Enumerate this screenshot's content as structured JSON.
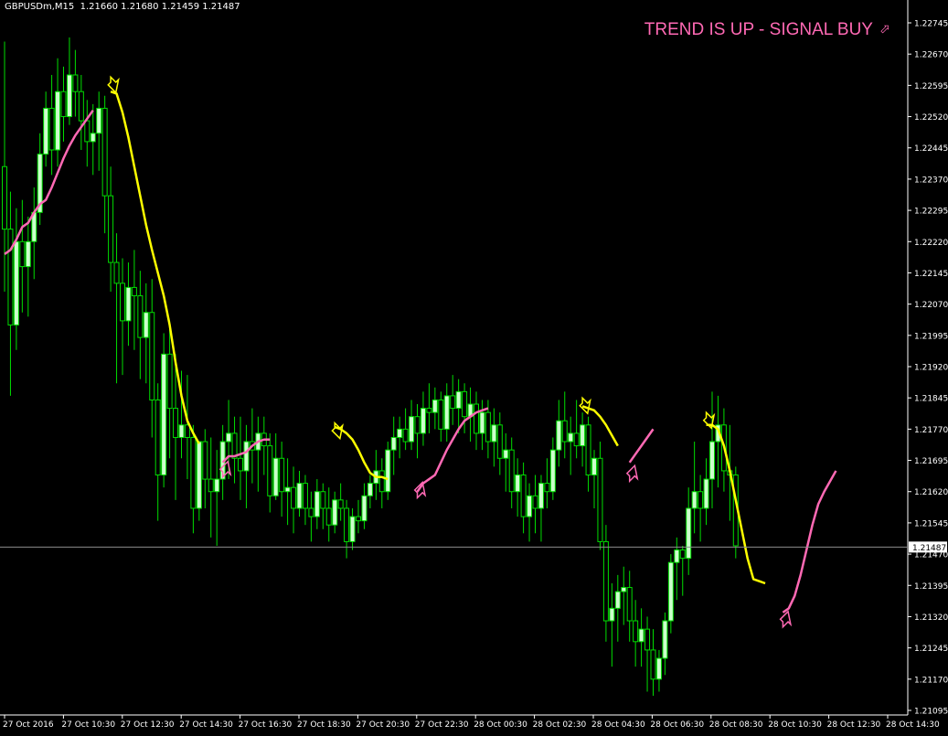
{
  "header": {
    "symbol_timeframe": "GBPUSDm,M15",
    "ohlc": "1.21660 1.21680 1.21459 1.21487"
  },
  "signal": {
    "text": "TREND IS UP - SIGNAL BUY",
    "icon": "arrow-up-right-icon",
    "color": "#ff69b4"
  },
  "colors": {
    "background": "#000000",
    "bull_candle": "#ccffcc",
    "wick": "#00dd00",
    "bear_candle": "#000000",
    "down_trend": "#ffff00",
    "up_trend": "#ff69b4",
    "axis_text": "#ffffff",
    "price_line": "#8c8c8c"
  },
  "chart_data": {
    "type": "candlestick",
    "symbol": "GBPUSDm",
    "timeframe": "M15",
    "y_ticks": [
      "1.22745",
      "1.22670",
      "1.22595",
      "1.22520",
      "1.22445",
      "1.22370",
      "1.22295",
      "1.22220",
      "1.22145",
      "1.22070",
      "1.21995",
      "1.21920",
      "1.21845",
      "1.21770",
      "1.21695",
      "1.21620",
      "1.21545",
      "1.21470",
      "1.21395",
      "1.21320",
      "1.21245",
      "1.21170",
      "1.21095"
    ],
    "ylim": [
      1.21095,
      1.22745
    ],
    "x_ticks": [
      "27 Oct 2016",
      "27 Oct 10:30",
      "27 Oct 12:30",
      "27 Oct 14:30",
      "27 Oct 16:30",
      "27 Oct 18:30",
      "27 Oct 20:30",
      "27 Oct 22:30",
      "28 Oct 00:30",
      "28 Oct 02:30",
      "28 Oct 04:30",
      "28 Oct 06:30",
      "28 Oct 08:30",
      "28 Oct 10:30",
      "28 Oct 12:30",
      "28 Oct 14:30"
    ],
    "current_price": "1.21487",
    "candles": [
      {
        "o": 1.224,
        "h": 1.227,
        "l": 1.221,
        "c": 1.2225
      },
      {
        "o": 1.2225,
        "h": 1.2234,
        "l": 1.2185,
        "c": 1.2202
      },
      {
        "o": 1.2202,
        "h": 1.223,
        "l": 1.2196,
        "c": 1.2222
      },
      {
        "o": 1.2222,
        "h": 1.2232,
        "l": 1.2205,
        "c": 1.2216
      },
      {
        "o": 1.2216,
        "h": 1.2228,
        "l": 1.2204,
        "c": 1.2222
      },
      {
        "o": 1.2222,
        "h": 1.2235,
        "l": 1.2213,
        "c": 1.2229
      },
      {
        "o": 1.2229,
        "h": 1.2248,
        "l": 1.2226,
        "c": 1.2243
      },
      {
        "o": 1.2243,
        "h": 1.2258,
        "l": 1.224,
        "c": 1.2254
      },
      {
        "o": 1.2254,
        "h": 1.2262,
        "l": 1.2238,
        "c": 1.2244
      },
      {
        "o": 1.2244,
        "h": 1.2266,
        "l": 1.224,
        "c": 1.2258
      },
      {
        "o": 1.2258,
        "h": 1.2264,
        "l": 1.2246,
        "c": 1.2252
      },
      {
        "o": 1.2252,
        "h": 1.2271,
        "l": 1.225,
        "c": 1.2262
      },
      {
        "o": 1.2262,
        "h": 1.2268,
        "l": 1.2252,
        "c": 1.2258
      },
      {
        "o": 1.2258,
        "h": 1.2262,
        "l": 1.2244,
        "c": 1.2251
      },
      {
        "o": 1.2251,
        "h": 1.2256,
        "l": 1.224,
        "c": 1.2246
      },
      {
        "o": 1.2246,
        "h": 1.2255,
        "l": 1.2238,
        "c": 1.2248
      },
      {
        "o": 1.2248,
        "h": 1.2258,
        "l": 1.2239,
        "c": 1.2254
      },
      {
        "o": 1.2254,
        "h": 1.2257,
        "l": 1.2224,
        "c": 1.2233
      },
      {
        "o": 1.2233,
        "h": 1.224,
        "l": 1.221,
        "c": 1.2217
      },
      {
        "o": 1.2217,
        "h": 1.2224,
        "l": 1.2188,
        "c": 1.2212
      },
      {
        "o": 1.2212,
        "h": 1.2218,
        "l": 1.219,
        "c": 1.2203
      },
      {
        "o": 1.2203,
        "h": 1.2217,
        "l": 1.2197,
        "c": 1.2211
      },
      {
        "o": 1.2211,
        "h": 1.222,
        "l": 1.2196,
        "c": 1.2209
      },
      {
        "o": 1.2209,
        "h": 1.2215,
        "l": 1.2189,
        "c": 1.2199
      },
      {
        "o": 1.2199,
        "h": 1.2212,
        "l": 1.2188,
        "c": 1.2205
      },
      {
        "o": 1.2205,
        "h": 1.2213,
        "l": 1.2175,
        "c": 1.2184
      },
      {
        "o": 1.2184,
        "h": 1.2188,
        "l": 1.2155,
        "c": 1.2166
      },
      {
        "o": 1.2166,
        "h": 1.22,
        "l": 1.2163,
        "c": 1.2195
      },
      {
        "o": 1.2195,
        "h": 1.2203,
        "l": 1.217,
        "c": 1.2182
      },
      {
        "o": 1.2182,
        "h": 1.2195,
        "l": 1.216,
        "c": 1.2175
      },
      {
        "o": 1.2175,
        "h": 1.2191,
        "l": 1.217,
        "c": 1.2178
      },
      {
        "o": 1.2178,
        "h": 1.219,
        "l": 1.2165,
        "c": 1.2175
      },
      {
        "o": 1.2175,
        "h": 1.2178,
        "l": 1.2152,
        "c": 1.2158
      },
      {
        "o": 1.2158,
        "h": 1.2173,
        "l": 1.2155,
        "c": 1.2174
      },
      {
        "o": 1.2174,
        "h": 1.2177,
        "l": 1.2158,
        "c": 1.2165
      },
      {
        "o": 1.2165,
        "h": 1.2175,
        "l": 1.2151,
        "c": 1.2162
      },
      {
        "o": 1.2162,
        "h": 1.2172,
        "l": 1.2149,
        "c": 1.2165
      },
      {
        "o": 1.2165,
        "h": 1.2178,
        "l": 1.216,
        "c": 1.2174
      },
      {
        "o": 1.2174,
        "h": 1.2184,
        "l": 1.2165,
        "c": 1.2176
      },
      {
        "o": 1.2176,
        "h": 1.218,
        "l": 1.2164,
        "c": 1.217
      },
      {
        "o": 1.217,
        "h": 1.218,
        "l": 1.216,
        "c": 1.2167
      },
      {
        "o": 1.2167,
        "h": 1.2178,
        "l": 1.2158,
        "c": 1.2174
      },
      {
        "o": 1.2174,
        "h": 1.2182,
        "l": 1.2164,
        "c": 1.2172
      },
      {
        "o": 1.2172,
        "h": 1.218,
        "l": 1.2162,
        "c": 1.2176
      },
      {
        "o": 1.2176,
        "h": 1.218,
        "l": 1.2166,
        "c": 1.2173
      },
      {
        "o": 1.2173,
        "h": 1.2176,
        "l": 1.2157,
        "c": 1.2161
      },
      {
        "o": 1.2161,
        "h": 1.2176,
        "l": 1.216,
        "c": 1.217
      },
      {
        "o": 1.217,
        "h": 1.2174,
        "l": 1.2156,
        "c": 1.2162
      },
      {
        "o": 1.2162,
        "h": 1.217,
        "l": 1.2154,
        "c": 1.2163
      },
      {
        "o": 1.2163,
        "h": 1.2168,
        "l": 1.2152,
        "c": 1.2158
      },
      {
        "o": 1.2158,
        "h": 1.2167,
        "l": 1.2156,
        "c": 1.2164
      },
      {
        "o": 1.2164,
        "h": 1.2166,
        "l": 1.2154,
        "c": 1.2158
      },
      {
        "o": 1.2158,
        "h": 1.2162,
        "l": 1.215,
        "c": 1.2156
      },
      {
        "o": 1.2156,
        "h": 1.2165,
        "l": 1.2153,
        "c": 1.2162
      },
      {
        "o": 1.2162,
        "h": 1.2164,
        "l": 1.2153,
        "c": 1.2158
      },
      {
        "o": 1.2158,
        "h": 1.2163,
        "l": 1.215,
        "c": 1.2154
      },
      {
        "o": 1.2154,
        "h": 1.2162,
        "l": 1.2152,
        "c": 1.216
      },
      {
        "o": 1.216,
        "h": 1.2164,
        "l": 1.2155,
        "c": 1.2158
      },
      {
        "o": 1.2158,
        "h": 1.216,
        "l": 1.2146,
        "c": 1.215
      },
      {
        "o": 1.215,
        "h": 1.2158,
        "l": 1.2148,
        "c": 1.2156
      },
      {
        "o": 1.2156,
        "h": 1.216,
        "l": 1.2152,
        "c": 1.2155
      },
      {
        "o": 1.2155,
        "h": 1.2164,
        "l": 1.2153,
        "c": 1.2161
      },
      {
        "o": 1.2161,
        "h": 1.2166,
        "l": 1.2158,
        "c": 1.2164
      },
      {
        "o": 1.2164,
        "h": 1.2172,
        "l": 1.216,
        "c": 1.2167
      },
      {
        "o": 1.2167,
        "h": 1.217,
        "l": 1.2158,
        "c": 1.2162
      },
      {
        "o": 1.2162,
        "h": 1.2174,
        "l": 1.216,
        "c": 1.2172
      },
      {
        "o": 1.2172,
        "h": 1.218,
        "l": 1.2166,
        "c": 1.2175
      },
      {
        "o": 1.2175,
        "h": 1.218,
        "l": 1.217,
        "c": 1.2177
      },
      {
        "o": 1.2177,
        "h": 1.2182,
        "l": 1.2172,
        "c": 1.2174
      },
      {
        "o": 1.2174,
        "h": 1.2184,
        "l": 1.2172,
        "c": 1.218
      },
      {
        "o": 1.218,
        "h": 1.2183,
        "l": 1.217,
        "c": 1.2176
      },
      {
        "o": 1.2176,
        "h": 1.2186,
        "l": 1.2173,
        "c": 1.2182
      },
      {
        "o": 1.2182,
        "h": 1.2188,
        "l": 1.2176,
        "c": 1.2181
      },
      {
        "o": 1.2181,
        "h": 1.2187,
        "l": 1.2177,
        "c": 1.2184
      },
      {
        "o": 1.2184,
        "h": 1.2186,
        "l": 1.2174,
        "c": 1.2177
      },
      {
        "o": 1.2177,
        "h": 1.2188,
        "l": 1.2174,
        "c": 1.2185
      },
      {
        "o": 1.2185,
        "h": 1.219,
        "l": 1.2178,
        "c": 1.2182
      },
      {
        "o": 1.2182,
        "h": 1.2189,
        "l": 1.2176,
        "c": 1.2186
      },
      {
        "o": 1.2186,
        "h": 1.2188,
        "l": 1.2176,
        "c": 1.218
      },
      {
        "o": 1.218,
        "h": 1.2187,
        "l": 1.2174,
        "c": 1.2183
      },
      {
        "o": 1.2183,
        "h": 1.2186,
        "l": 1.2172,
        "c": 1.2176
      },
      {
        "o": 1.2176,
        "h": 1.2184,
        "l": 1.2172,
        "c": 1.2181
      },
      {
        "o": 1.2181,
        "h": 1.2184,
        "l": 1.217,
        "c": 1.2174
      },
      {
        "o": 1.2174,
        "h": 1.2182,
        "l": 1.2168,
        "c": 1.2178
      },
      {
        "o": 1.2178,
        "h": 1.2181,
        "l": 1.2166,
        "c": 1.217
      },
      {
        "o": 1.217,
        "h": 1.2176,
        "l": 1.2162,
        "c": 1.2172
      },
      {
        "o": 1.2172,
        "h": 1.2175,
        "l": 1.2158,
        "c": 1.2162
      },
      {
        "o": 1.2162,
        "h": 1.217,
        "l": 1.2156,
        "c": 1.2166
      },
      {
        "o": 1.2166,
        "h": 1.2169,
        "l": 1.2152,
        "c": 1.2156
      },
      {
        "o": 1.2156,
        "h": 1.2164,
        "l": 1.215,
        "c": 1.2161
      },
      {
        "o": 1.2161,
        "h": 1.2166,
        "l": 1.2152,
        "c": 1.2158
      },
      {
        "o": 1.2158,
        "h": 1.2166,
        "l": 1.215,
        "c": 1.2164
      },
      {
        "o": 1.2164,
        "h": 1.217,
        "l": 1.2158,
        "c": 1.2162
      },
      {
        "o": 1.2162,
        "h": 1.2175,
        "l": 1.216,
        "c": 1.2172
      },
      {
        "o": 1.2172,
        "h": 1.2184,
        "l": 1.2168,
        "c": 1.2179
      },
      {
        "o": 1.2179,
        "h": 1.2186,
        "l": 1.217,
        "c": 1.2174
      },
      {
        "o": 1.2174,
        "h": 1.218,
        "l": 1.2166,
        "c": 1.2176
      },
      {
        "o": 1.2176,
        "h": 1.2184,
        "l": 1.217,
        "c": 1.2173
      },
      {
        "o": 1.2173,
        "h": 1.2181,
        "l": 1.2168,
        "c": 1.2178
      },
      {
        "o": 1.2178,
        "h": 1.218,
        "l": 1.2162,
        "c": 1.2166
      },
      {
        "o": 1.2166,
        "h": 1.2172,
        "l": 1.2158,
        "c": 1.217
      },
      {
        "o": 1.217,
        "h": 1.2174,
        "l": 1.2148,
        "c": 1.215
      },
      {
        "o": 1.215,
        "h": 1.2154,
        "l": 1.2126,
        "c": 1.2131
      },
      {
        "o": 1.2131,
        "h": 1.214,
        "l": 1.212,
        "c": 1.2134
      },
      {
        "o": 1.2134,
        "h": 1.2142,
        "l": 1.2126,
        "c": 1.2138
      },
      {
        "o": 1.2138,
        "h": 1.2144,
        "l": 1.213,
        "c": 1.2139
      },
      {
        "o": 1.2139,
        "h": 1.2143,
        "l": 1.2126,
        "c": 1.2131
      },
      {
        "o": 1.2131,
        "h": 1.2136,
        "l": 1.212,
        "c": 1.2126
      },
      {
        "o": 1.2126,
        "h": 1.2134,
        "l": 1.212,
        "c": 1.2129
      },
      {
        "o": 1.2129,
        "h": 1.2132,
        "l": 1.2114,
        "c": 1.2124
      },
      {
        "o": 1.2124,
        "h": 1.2129,
        "l": 1.2113,
        "c": 1.2117
      },
      {
        "o": 1.2117,
        "h": 1.2124,
        "l": 1.2114,
        "c": 1.2122
      },
      {
        "o": 1.2122,
        "h": 1.2133,
        "l": 1.2118,
        "c": 1.2131
      },
      {
        "o": 1.2131,
        "h": 1.2147,
        "l": 1.2128,
        "c": 1.2145
      },
      {
        "o": 1.2145,
        "h": 1.2151,
        "l": 1.2136,
        "c": 1.2148
      },
      {
        "o": 1.2148,
        "h": 1.2149,
        "l": 1.2137,
        "c": 1.2146
      },
      {
        "o": 1.2146,
        "h": 1.2163,
        "l": 1.2142,
        "c": 1.2158
      },
      {
        "o": 1.2158,
        "h": 1.2174,
        "l": 1.2152,
        "c": 1.2162
      },
      {
        "o": 1.2162,
        "h": 1.2166,
        "l": 1.215,
        "c": 1.2158
      },
      {
        "o": 1.2158,
        "h": 1.217,
        "l": 1.2154,
        "c": 1.2165
      },
      {
        "o": 1.2165,
        "h": 1.2186,
        "l": 1.2158,
        "c": 1.2174
      },
      {
        "o": 1.2174,
        "h": 1.2185,
        "l": 1.2163,
        "c": 1.2178
      },
      {
        "o": 1.2178,
        "h": 1.2182,
        "l": 1.2162,
        "c": 1.2167
      },
      {
        "o": 1.2167,
        "h": 1.2178,
        "l": 1.2155,
        "c": 1.2166
      },
      {
        "o": 1.2166,
        "h": 1.2168,
        "l": 1.2146,
        "c": 1.2149
      }
    ],
    "down_trend_line": [
      {
        "i": 18,
        "v": 1.2258
      },
      {
        "i": 19,
        "v": 1.22575
      },
      {
        "i": 20,
        "v": 1.2253
      },
      {
        "i": 21,
        "v": 1.2247
      },
      {
        "i": 22,
        "v": 1.224
      },
      {
        "i": 23,
        "v": 1.2233
      },
      {
        "i": 24,
        "v": 1.2226
      },
      {
        "i": 25,
        "v": 1.222
      },
      {
        "i": 26,
        "v": 1.22145
      },
      {
        "i": 27,
        "v": 1.2209
      },
      {
        "i": 28,
        "v": 1.2202
      },
      {
        "i": 29,
        "v": 1.2193
      },
      {
        "i": 30,
        "v": 1.2185
      },
      {
        "i": 31,
        "v": 1.2179
      },
      {
        "i": 32,
        "v": 1.2176
      },
      {
        "i": 33,
        "v": 1.21735
      },
      {
        "i": 56,
        "v": 1.21775
      },
      {
        "i": 57,
        "v": 1.2177
      },
      {
        "i": 58,
        "v": 1.2176
      },
      {
        "i": 59,
        "v": 1.21745
      },
      {
        "i": 60,
        "v": 1.2172
      },
      {
        "i": 61,
        "v": 1.2169
      },
      {
        "i": 62,
        "v": 1.21665
      },
      {
        "i": 63,
        "v": 1.21655
      },
      {
        "i": 64,
        "v": 1.21655
      },
      {
        "i": 65,
        "v": 1.2165
      },
      {
        "i": 98,
        "v": 1.21825
      },
      {
        "i": 99,
        "v": 1.2182
      },
      {
        "i": 100,
        "v": 1.21815
      },
      {
        "i": 101,
        "v": 1.218
      },
      {
        "i": 102,
        "v": 1.2178
      },
      {
        "i": 103,
        "v": 1.21755
      },
      {
        "i": 104,
        "v": 1.2173
      },
      {
        "i": 119,
        "v": 1.2178
      },
      {
        "i": 120,
        "v": 1.2178
      },
      {
        "i": 121,
        "v": 1.2177
      },
      {
        "i": 122,
        "v": 1.2173
      },
      {
        "i": 123,
        "v": 1.2167
      },
      {
        "i": 124,
        "v": 1.216
      },
      {
        "i": 125,
        "v": 1.2153
      },
      {
        "i": 126,
        "v": 1.2146
      },
      {
        "i": 127,
        "v": 1.2141
      },
      {
        "i": 128,
        "v": 1.21405
      },
      {
        "i": 129,
        "v": 1.214
      }
    ],
    "up_trend_line": [
      {
        "i": 0,
        "v": 1.2219
      },
      {
        "i": 1,
        "v": 1.222
      },
      {
        "i": 2,
        "v": 1.22225
      },
      {
        "i": 3,
        "v": 1.22255
      },
      {
        "i": 4,
        "v": 1.22265
      },
      {
        "i": 5,
        "v": 1.2229
      },
      {
        "i": 6,
        "v": 1.2231
      },
      {
        "i": 7,
        "v": 1.2232
      },
      {
        "i": 8,
        "v": 1.2235
      },
      {
        "i": 9,
        "v": 1.22385
      },
      {
        "i": 10,
        "v": 1.2242
      },
      {
        "i": 11,
        "v": 1.2245
      },
      {
        "i": 12,
        "v": 1.22475
      },
      {
        "i": 13,
        "v": 1.22495
      },
      {
        "i": 14,
        "v": 1.22515
      },
      {
        "i": 15,
        "v": 1.22535
      },
      {
        "i": 37,
        "v": 1.2169
      },
      {
        "i": 38,
        "v": 1.21705
      },
      {
        "i": 39,
        "v": 1.21705
      },
      {
        "i": 40,
        "v": 1.2171
      },
      {
        "i": 41,
        "v": 1.21715
      },
      {
        "i": 42,
        "v": 1.2173
      },
      {
        "i": 43,
        "v": 1.2174
      },
      {
        "i": 44,
        "v": 1.21745
      },
      {
        "i": 45,
        "v": 1.21745
      },
      {
        "i": 70,
        "v": 1.2162
      },
      {
        "i": 71,
        "v": 1.2164
      },
      {
        "i": 72,
        "v": 1.2165
      },
      {
        "i": 73,
        "v": 1.2166
      },
      {
        "i": 74,
        "v": 1.2169
      },
      {
        "i": 75,
        "v": 1.2172
      },
      {
        "i": 76,
        "v": 1.21745
      },
      {
        "i": 77,
        "v": 1.2177
      },
      {
        "i": 78,
        "v": 1.2179
      },
      {
        "i": 79,
        "v": 1.218
      },
      {
        "i": 80,
        "v": 1.2181
      },
      {
        "i": 81,
        "v": 1.21815
      },
      {
        "i": 82,
        "v": 1.2182
      },
      {
        "i": 106,
        "v": 1.2169
      },
      {
        "i": 107,
        "v": 1.2171
      },
      {
        "i": 108,
        "v": 1.2173
      },
      {
        "i": 109,
        "v": 1.2175
      },
      {
        "i": 110,
        "v": 1.2177
      },
      {
        "i": 132,
        "v": 1.2133
      },
      {
        "i": 133,
        "v": 1.2134
      },
      {
        "i": 134,
        "v": 1.2137
      },
      {
        "i": 135,
        "v": 1.2142
      },
      {
        "i": 136,
        "v": 1.2148
      },
      {
        "i": 137,
        "v": 1.2154
      },
      {
        "i": 138,
        "v": 1.2159
      },
      {
        "i": 139,
        "v": 1.2162
      },
      {
        "i": 140,
        "v": 1.21645
      },
      {
        "i": 141,
        "v": 1.2167
      }
    ],
    "sell_arrows": [
      {
        "i": 18,
        "v": 1.2259
      },
      {
        "i": 56,
        "v": 1.2176
      },
      {
        "i": 98,
        "v": 1.2182
      },
      {
        "i": 119,
        "v": 1.21785
      }
    ],
    "buy_arrows": [
      {
        "i": 37,
        "v": 1.2168
      },
      {
        "i": 70,
        "v": 1.2163
      },
      {
        "i": 106,
        "v": 1.2167
      },
      {
        "i": 132,
        "v": 1.2132
      }
    ]
  }
}
